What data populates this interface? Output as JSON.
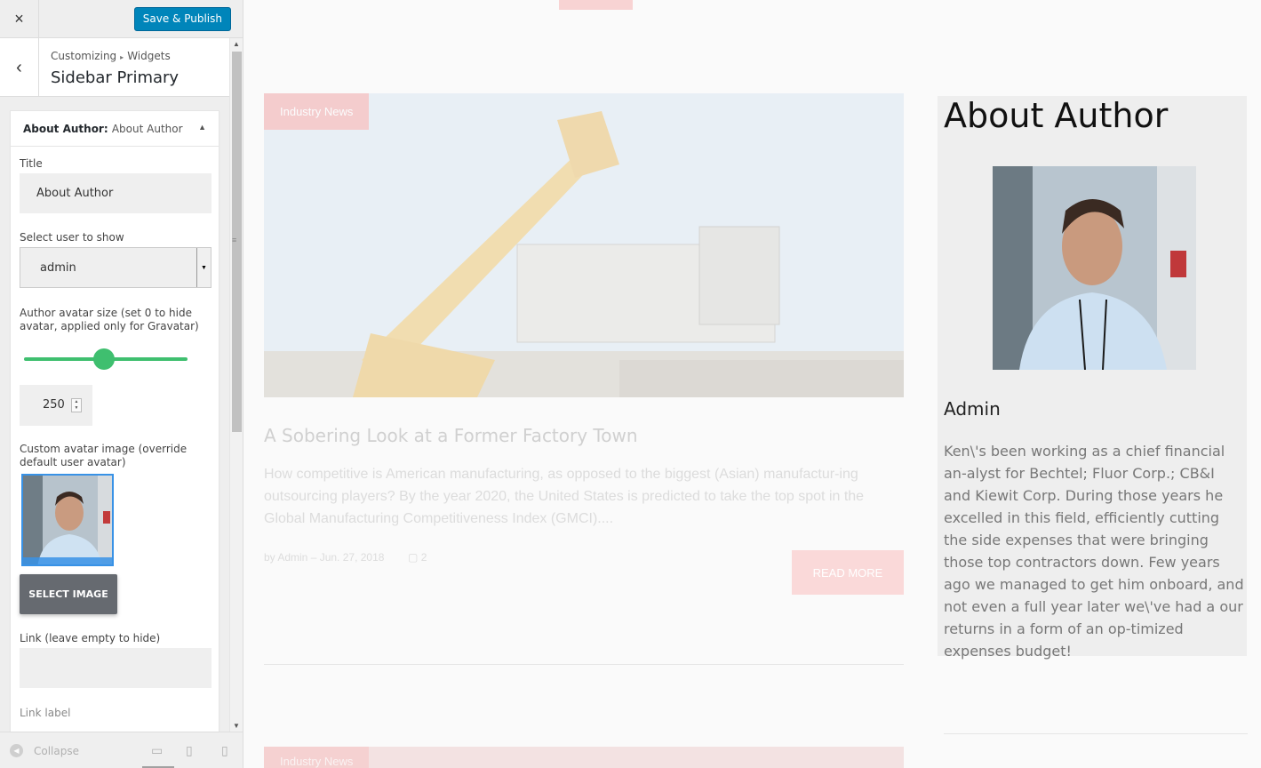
{
  "panel": {
    "save_label": "Save & Publish",
    "close_icon": "×",
    "back_icon": "‹",
    "breadcrumb": [
      "Customizing",
      "Widgets"
    ],
    "section_title": "Sidebar Primary"
  },
  "widget": {
    "title_bold": "About Author:",
    "title_instance": "About Author",
    "title_label": "Title",
    "title_value": "About Author",
    "user_label": "Select user to show",
    "user_value": "admin",
    "avatar_size_label": "Author avatar size (set 0 to hide avatar, applied only for Gravatar)",
    "avatar_size_value": "250",
    "avatar_size_slider_fraction": 0.49,
    "custom_avatar_label": "Custom avatar image (override default user avatar)",
    "select_image_label": "SELECT IMAGE",
    "link_label": "Link (leave empty to hide)",
    "link_value": "",
    "link_text_label": "Link label"
  },
  "footer": {
    "collapse_label": "Collapse",
    "devices": [
      "desktop-icon",
      "tablet-icon",
      "mobile-icon"
    ]
  },
  "preview": {
    "post": {
      "category": "Industry News",
      "title": "A Sobering Look at a Former Factory Town",
      "excerpt": "How competitive is American manufacturing, as opposed to the biggest (Asian) manufactur-ing outsourcing players? By the year 2020, the United States is predicted to take the top spot in the Global Manufacturing Competitiveness Index (GMCI)....",
      "meta": "by Admin – Jun. 27, 2018",
      "comments": "2",
      "read_more": "READ MORE"
    },
    "next_post_category": "Industry News",
    "about": {
      "heading": "About Author",
      "name": "Admin",
      "bio": "Ken\\'s been working as a chief financial an-alyst for Bechtel; Fluor Corp.; CB&I and Kiewit Corp. During those years he excelled in this field, efficiently cutting the side expenses that were bringing those top contractors down. Few years ago we managed to get him onboard, and not even a full year later we\\'ve had a our returns in a form of an op-timized expenses budget!"
    }
  },
  "colors": {
    "save_button": "#0085ba",
    "slider": "#3fbf6f",
    "accent_pink": "#f7c7c7",
    "avatar_border": "#3892e6"
  }
}
